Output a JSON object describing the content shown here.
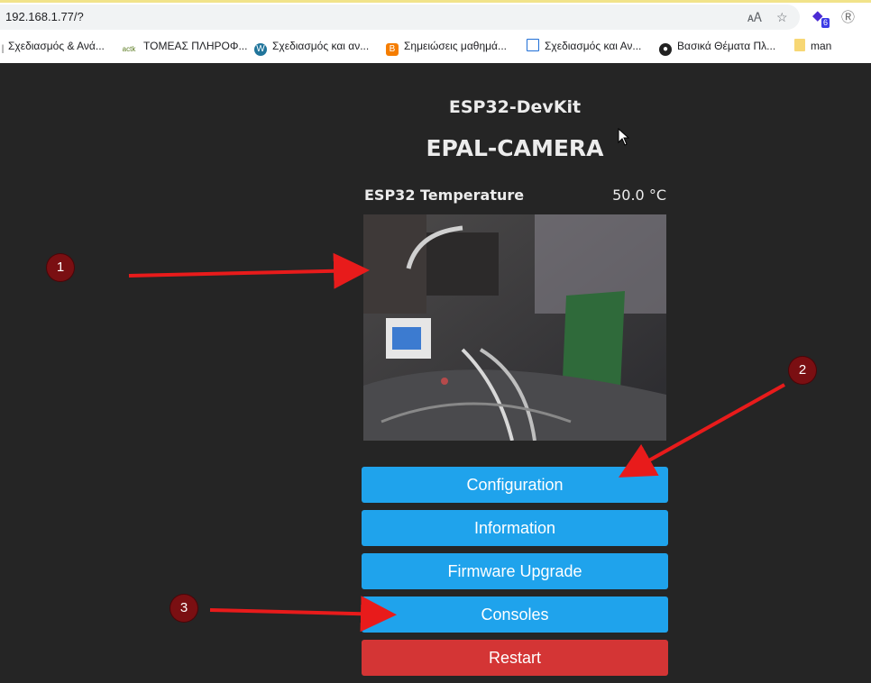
{
  "browser": {
    "url": "192.168.1.77/?",
    "bookmarks": [
      {
        "label": "Σχεδιασμός & Ανά...",
        "icon": "blank-page-icon"
      },
      {
        "label": "ΤΟΜΕΑΣ ΠΛΗΡΟΦ...",
        "icon": "site-logo-icon"
      },
      {
        "label": "Σχεδιασμός και αν...",
        "icon": "wordpress-icon"
      },
      {
        "label": "Σημειώσεις μαθημά...",
        "icon": "blogger-icon"
      },
      {
        "label": "Σχεδιασμός και Αν...",
        "icon": "layout-icon"
      },
      {
        "label": "Βασικά Θέματα Πλ...",
        "icon": "globe-icon"
      },
      {
        "label": "man",
        "icon": "folder-icon"
      }
    ],
    "extension_badge": "6"
  },
  "page": {
    "device_name": "ESP32-DevKit",
    "title": "EPAL-CAMERA",
    "temperature_label": "ESP32 Temperature",
    "temperature_value": "50.0 °C",
    "buttons": {
      "configuration": "Configuration",
      "information": "Information",
      "firmware": "Firmware Upgrade",
      "consoles": "Consoles",
      "restart": "Restart"
    }
  },
  "annotations": {
    "marker1": "1",
    "marker2": "2",
    "marker3": "3"
  },
  "colors": {
    "background": "#252525",
    "button_blue": "#1fa3ec",
    "button_red": "#d43535",
    "marker": "#7a0f12",
    "arrow": "#e81b1b"
  }
}
